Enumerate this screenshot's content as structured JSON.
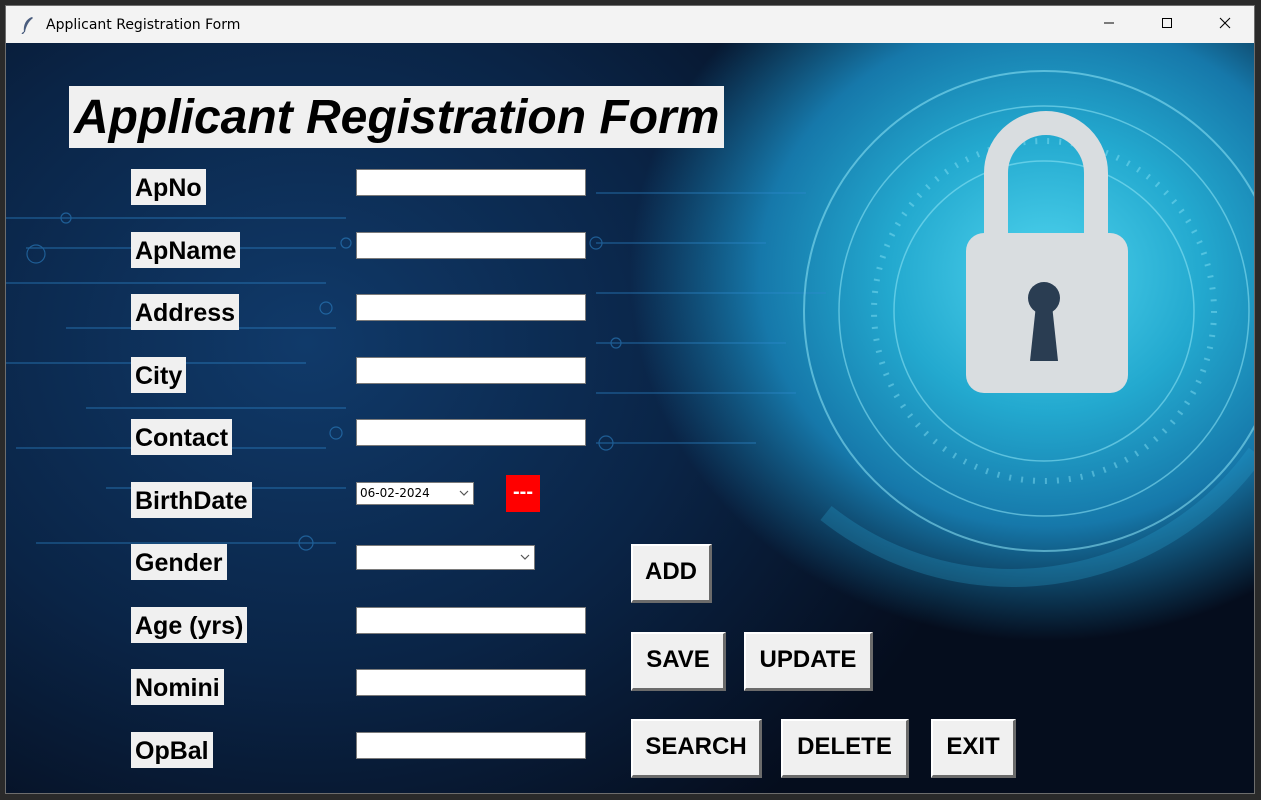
{
  "window": {
    "title": "Applicant Registration Form",
    "controls": [
      "minimize",
      "maximize",
      "close"
    ]
  },
  "form": {
    "heading": "Applicant Registration Form",
    "fields": [
      {
        "label": "ApNo",
        "value": ""
      },
      {
        "label": "ApName",
        "value": ""
      },
      {
        "label": "Address",
        "value": ""
      },
      {
        "label": "City",
        "value": ""
      },
      {
        "label": "Contact",
        "value": ""
      },
      {
        "label": "BirthDate",
        "value": "06-02-2024"
      },
      {
        "label": "Gender",
        "value": ""
      },
      {
        "label": "Age (yrs)",
        "value": ""
      },
      {
        "label": "Nomini",
        "value": ""
      },
      {
        "label": "OpBal",
        "value": ""
      }
    ],
    "date_reset_label": "---"
  },
  "buttons": {
    "add": "ADD",
    "save": "SAVE",
    "update": "UPDATE",
    "search": "SEARCH",
    "delete": "DELETE",
    "exit": "EXIT"
  },
  "colors": {
    "accent_red": "#ff0000",
    "bg_dark": "#0a2446",
    "bg_cyan": "#23a9cf"
  },
  "icons": {
    "app": "feather-icon",
    "background": "padlock-icon"
  }
}
